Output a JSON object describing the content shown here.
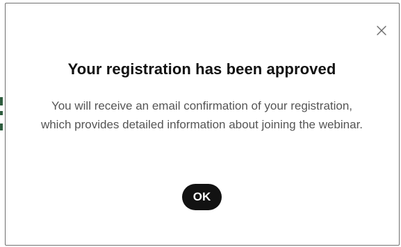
{
  "dialog": {
    "title": "Your registration has been approved",
    "message": "You will receive an email confirmation of your registration, which provides detailed information about joining the webinar.",
    "ok_label": "OK",
    "close_icon": "close-icon"
  },
  "colors": {
    "button_bg": "#121212",
    "button_text": "#ffffff",
    "title_text": "#111111",
    "body_text": "#555555",
    "dialog_border": "#6f6f6f"
  }
}
